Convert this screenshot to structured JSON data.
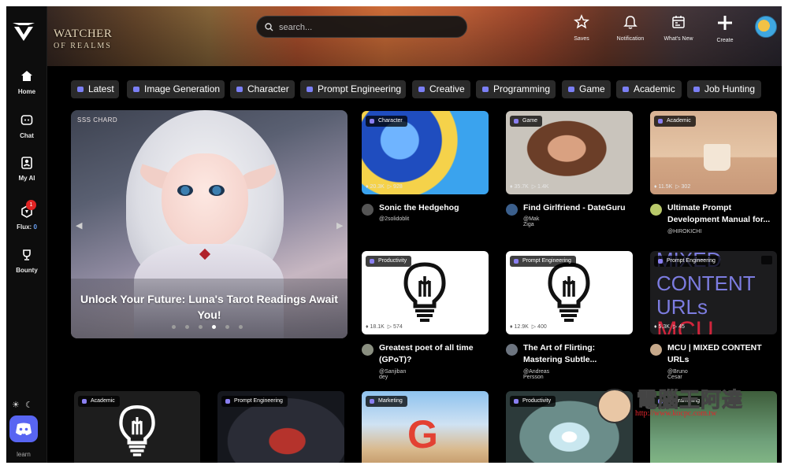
{
  "sidebar": {
    "items": [
      {
        "label": "Home"
      },
      {
        "label": "Chat"
      },
      {
        "label": "My AI"
      },
      {
        "label": "Flux:",
        "value": "0",
        "badge": "1"
      },
      {
        "label": "Bounty"
      }
    ],
    "theme_icons": [
      "sun-icon",
      "moon-icon"
    ],
    "learn_label": "learn"
  },
  "header": {
    "banner_title": "WATCHER",
    "banner_subtitle": "OF REALMS",
    "search_placeholder": "search...",
    "actions": [
      {
        "label": "Saves",
        "icon": "star-icon"
      },
      {
        "label": "Notification",
        "icon": "bell-icon"
      },
      {
        "label": "What's New",
        "icon": "calendar-icon"
      },
      {
        "label": "Create",
        "icon": "plus-icon"
      }
    ]
  },
  "categories": [
    "Latest",
    "Image Generation",
    "Character",
    "Prompt Engineering",
    "Creative",
    "Programming",
    "Game",
    "Academic",
    "Job Hunting"
  ],
  "hero": {
    "brand": "SSS CHARD",
    "title": "Unlock Your Future: Luna's Tarot Readings Await You!",
    "active_slide": 4,
    "slide_count": 6
  },
  "cards": [
    {
      "tag": "Character",
      "views": "20.3K",
      "plays": "928",
      "title": "Sonic the Hedgehog",
      "author": "@2solidoblit"
    },
    {
      "tag": "Game",
      "views": "35.7K",
      "plays": "1.4K",
      "title": "Find Girlfriend - DateGuru",
      "author": "@Mak Ziga"
    },
    {
      "tag": "Academic",
      "views": "11.5K",
      "plays": "302",
      "title": "Ultimate Prompt Development Manual for...",
      "author": "@HIROKICHI"
    },
    {
      "tag": "Productivity",
      "views": "18.1K",
      "plays": "574",
      "title": "Greatest poet of all time (GPoT)?",
      "author": "@Sanjiban dey"
    },
    {
      "tag": "Prompt Engineering",
      "views": "12.9K",
      "plays": "400",
      "title": "The Art of Flirting: Mastering Subtle...",
      "author": "@Andreas Persson"
    },
    {
      "tag": "Prompt Engineering",
      "views": "5.3K",
      "plays": "45",
      "title": "MCU | MIXED CONTENT URLs",
      "author": "@Bruno Cesar",
      "thumb_text": [
        "MIXED",
        "CONTENT",
        "URLs",
        "MCU"
      ]
    }
  ],
  "bottom_cards": [
    {
      "tag": "Academic"
    },
    {
      "tag": "Prompt Engineering"
    },
    {
      "tag": "Marketing"
    },
    {
      "tag": "Productivity"
    },
    {
      "tag": "Programming"
    }
  ],
  "watermark": {
    "text": "電腦王阿達",
    "url": "http://www.kocpc.com.tw"
  },
  "colors": {
    "background": "#000000",
    "chip_bg": "#2a2a2a",
    "accent": "#7b7ff5",
    "badge": "#e02424",
    "discord": "#5865f2"
  }
}
